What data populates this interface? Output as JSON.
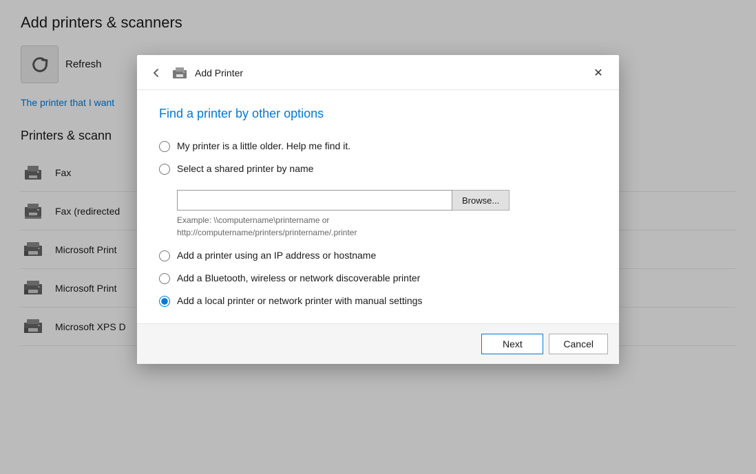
{
  "settings": {
    "title": "Add printers & scanners",
    "refresh_label": "Refresh",
    "link_text": "The printer that I want",
    "printers_title": "Printers & scann",
    "printers": [
      {
        "name": "Fax"
      },
      {
        "name": "Fax (redirected"
      },
      {
        "name": "Microsoft Print"
      },
      {
        "name": "Microsoft Print"
      },
      {
        "name": "Microsoft XPS D"
      }
    ]
  },
  "modal": {
    "title": "Add Printer",
    "section_title": "Find a printer by other options",
    "back_icon": "←",
    "close_icon": "✕",
    "options": [
      {
        "id": "opt1",
        "label": "My printer is a little older. Help me find it.",
        "checked": false
      },
      {
        "id": "opt2",
        "label": "Select a shared printer by name",
        "checked": false
      },
      {
        "id": "opt3",
        "label": "Add a printer using an IP address or hostname",
        "checked": false
      },
      {
        "id": "opt4",
        "label": "Add a Bluetooth, wireless or network discoverable printer",
        "checked": false
      },
      {
        "id": "opt5",
        "label": "Add a local printer or network printer with manual settings",
        "checked": true
      }
    ],
    "shared_input_placeholder": "",
    "browse_label": "Browse...",
    "example_text": "Example: \\\\computername\\printername or\nhttp://computername/printers/printername/.printer",
    "footer": {
      "next_label": "Next",
      "cancel_label": "Cancel"
    }
  }
}
